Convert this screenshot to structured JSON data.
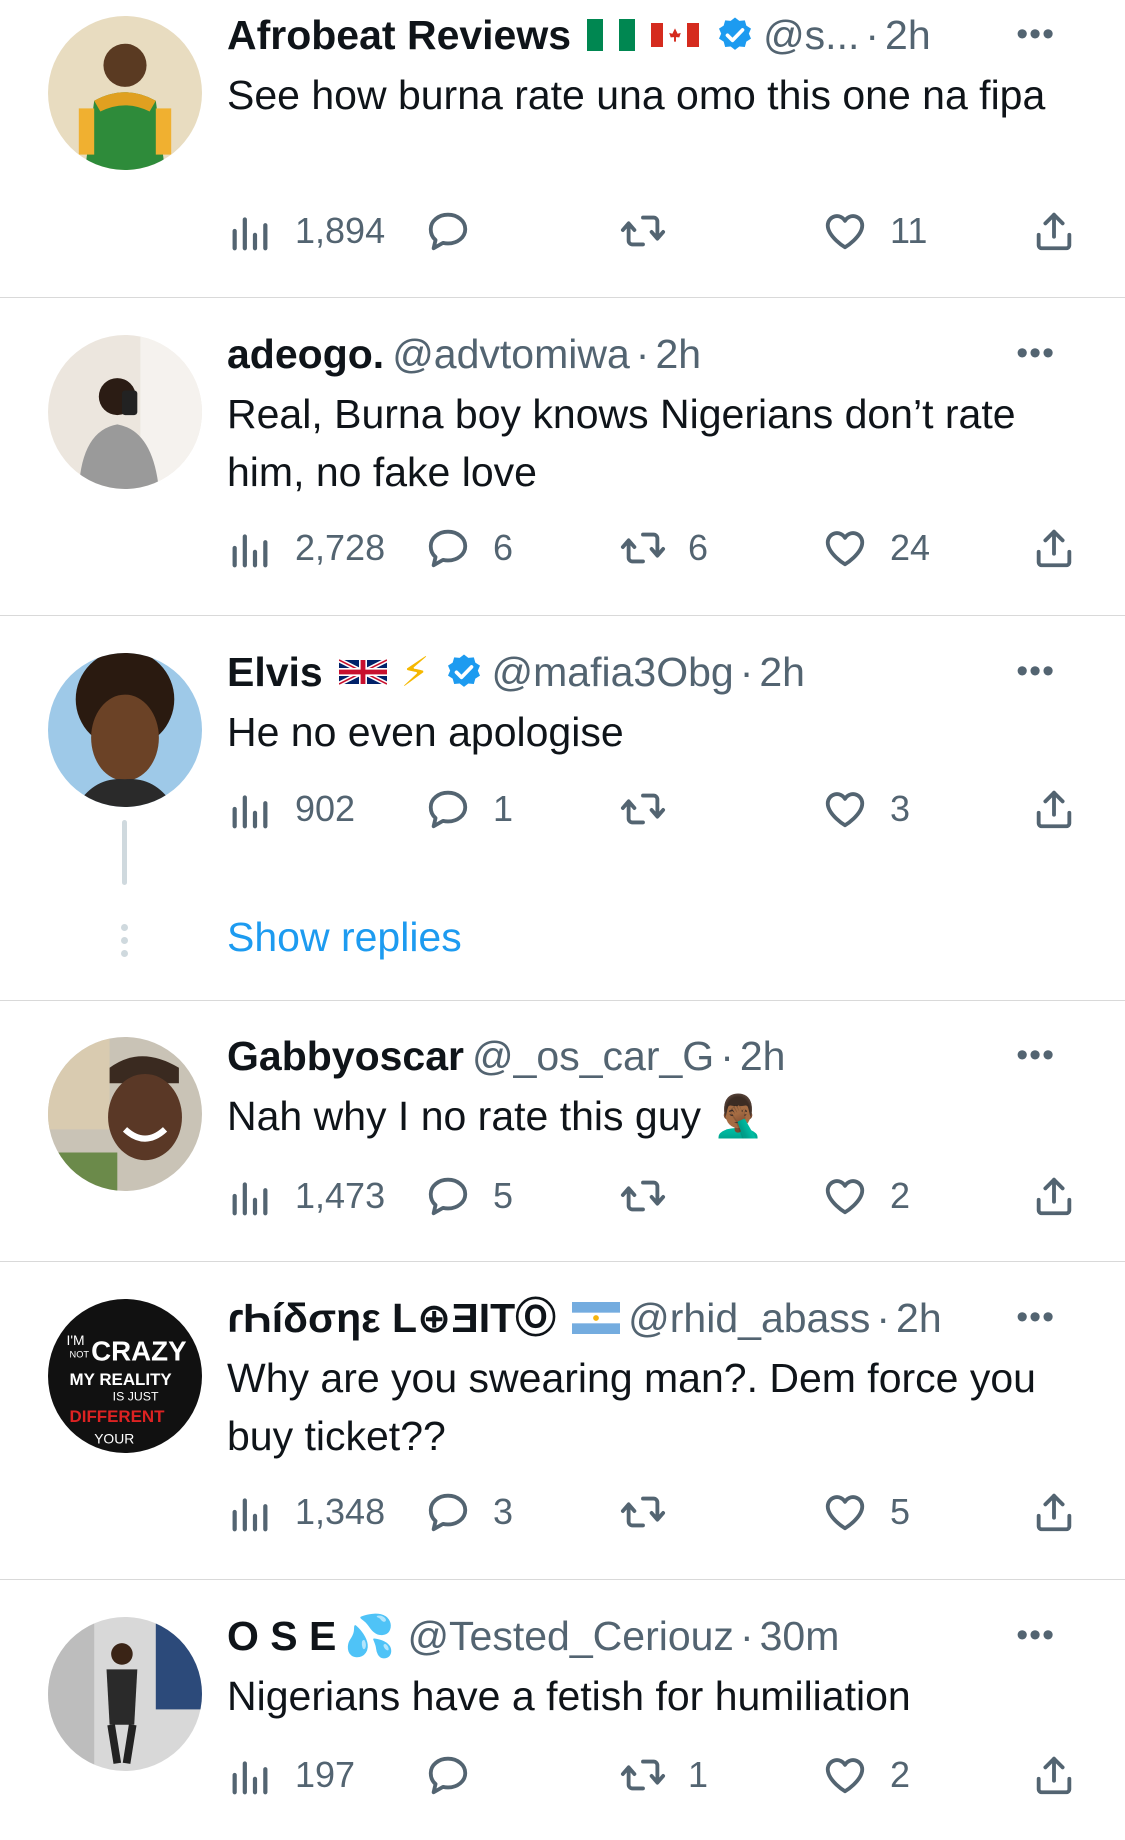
{
  "colors": {
    "accent": "#1d9bf0",
    "text": "#0f1419",
    "secondary": "#536471",
    "divider": "#d9d9d9",
    "thread_line": "#cfd9de"
  },
  "tweets": [
    {
      "name": "Afrobeat Reviews",
      "flags": [
        "nigeria-flag",
        "canada-flag"
      ],
      "verified": true,
      "handle": "@s...",
      "sep": "·",
      "time": "2h",
      "more": "•••",
      "text": "See how burna rate una omo this one na fipa",
      "views": "1,894",
      "replies": "",
      "retweets": "",
      "likes": "11"
    },
    {
      "name": "adeogo.",
      "handle": "@advtomiwa",
      "sep": "·",
      "time": "2h",
      "more": "•••",
      "text": "Real, Burna boy knows Nigerians don’t rate him, no fake love",
      "views": "2,728",
      "replies": "6",
      "retweets": "6",
      "likes": "24"
    },
    {
      "name": "Elvis",
      "flags": [
        "uk-flag"
      ],
      "emoji": "⚡",
      "verified": true,
      "handle": "@mafia3Obg",
      "sep": "·",
      "time": "2h",
      "more": "•••",
      "text": "He no even apologise",
      "views": "902",
      "replies": "1",
      "retweets": "",
      "likes": "3",
      "show_replies": "Show replies"
    },
    {
      "name": "Gabbyoscar",
      "handle": "@_os_car_G",
      "sep": "·",
      "time": "2h",
      "more": "•••",
      "text": "Nah why I no rate this guy",
      "text_emoji": "🤦🏾‍♂️",
      "views": "1,473",
      "replies": "5",
      "retweets": "",
      "likes": "2"
    },
    {
      "name": "ɾҺíδσηε L⊕ƎITⓄ",
      "flags": [
        "argentina-flag"
      ],
      "handle": "@rhid_abass",
      "sep": "·",
      "time": "2h",
      "more": "•••",
      "text": "Why are you swearing man?. Dem force you buy ticket??",
      "views": "1,348",
      "replies": "3",
      "retweets": "",
      "likes": "5",
      "avatar_text": [
        "I'M",
        "NOT",
        "CRAZY",
        "MY REALITY",
        "IS JUST",
        "DIFFERENT",
        "YOUR"
      ]
    },
    {
      "name": "O S E",
      "emoji": "💦",
      "handle": "@Tested_Ceriouz",
      "sep": "·",
      "time": "30m",
      "more": "•••",
      "text": "Nigerians have a fetish for humiliation",
      "views": "197",
      "replies": "",
      "retweets": "1",
      "likes": "2"
    }
  ]
}
